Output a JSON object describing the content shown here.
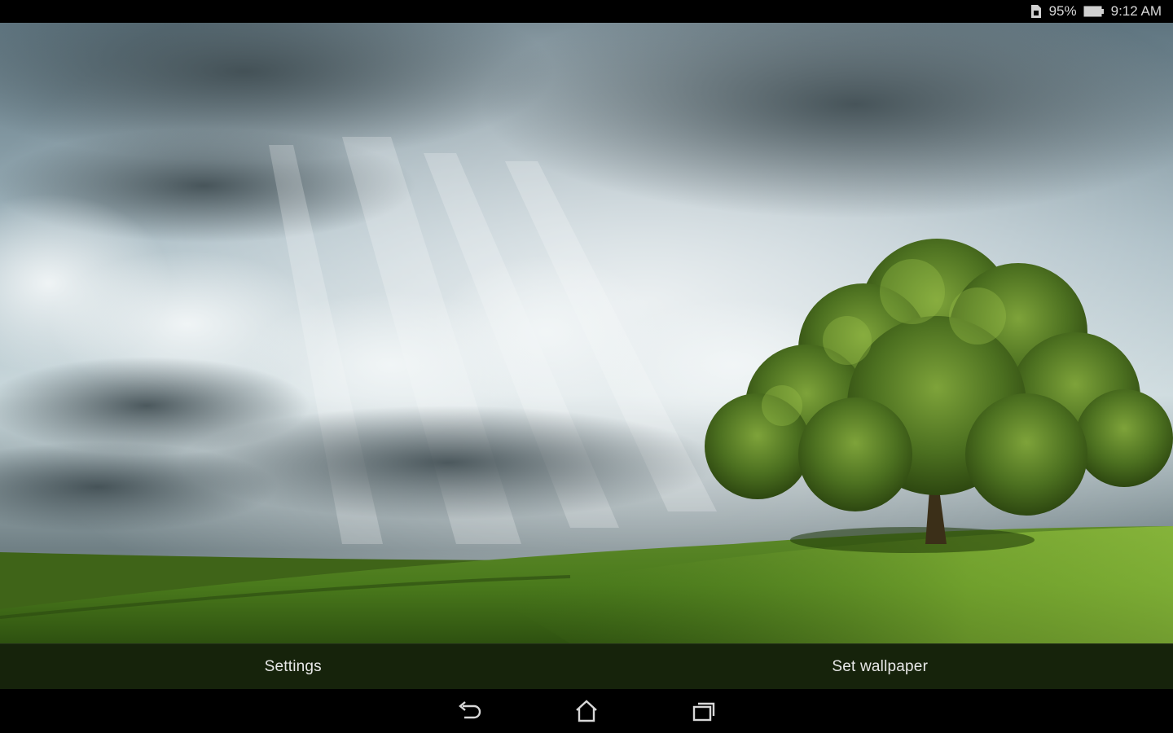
{
  "status_bar": {
    "battery_percent": "95%",
    "time": "9:12 AM",
    "icons": [
      "sim-card-icon",
      "battery-icon"
    ]
  },
  "wallpaper": {
    "description_icon": "tree-landscape-wallpaper"
  },
  "action_bar": {
    "settings_label": "Settings",
    "set_wallpaper_label": "Set wallpaper"
  },
  "nav_bar": {
    "icons": [
      "back-icon",
      "home-icon",
      "recent-apps-icon"
    ]
  },
  "colors": {
    "status_bar_bg": "#000000",
    "action_bar_bg": "#18260c",
    "text": "#e8e8e8"
  }
}
